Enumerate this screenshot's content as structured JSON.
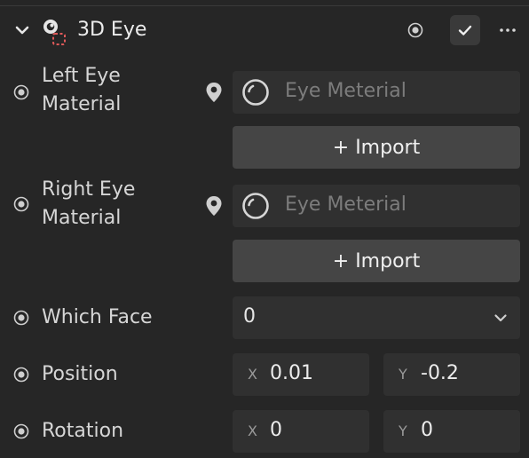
{
  "header": {
    "title": "3D Eye",
    "collapse_icon": "chevron-down-icon",
    "component_icon": "eye-with-selection-icon",
    "more_icon": "more-dots-icon",
    "check_icon": "check-icon"
  },
  "left_eye": {
    "label_line1": "Left Eye",
    "label_line2": "Material",
    "value": "Eye Meterial",
    "import_label": "+ Import"
  },
  "right_eye": {
    "label_line1": "Right Eye",
    "label_line2": "Material",
    "value": "Eye Meterial",
    "import_label": "+ Import"
  },
  "which_face": {
    "label": "Which Face",
    "value": "0"
  },
  "position": {
    "label": "Position",
    "x_axis": "X",
    "x_value": "0.01",
    "y_axis": "Y",
    "y_value": "-0.2"
  },
  "rotation": {
    "label": "Rotation",
    "x_axis": "X",
    "x_value": "0",
    "y_axis": "Y",
    "y_value": "0"
  },
  "colors": {
    "panel_bg": "#262626",
    "field_bg": "#303030",
    "button_bg": "#454545",
    "accent_red": "#e05a5a"
  }
}
